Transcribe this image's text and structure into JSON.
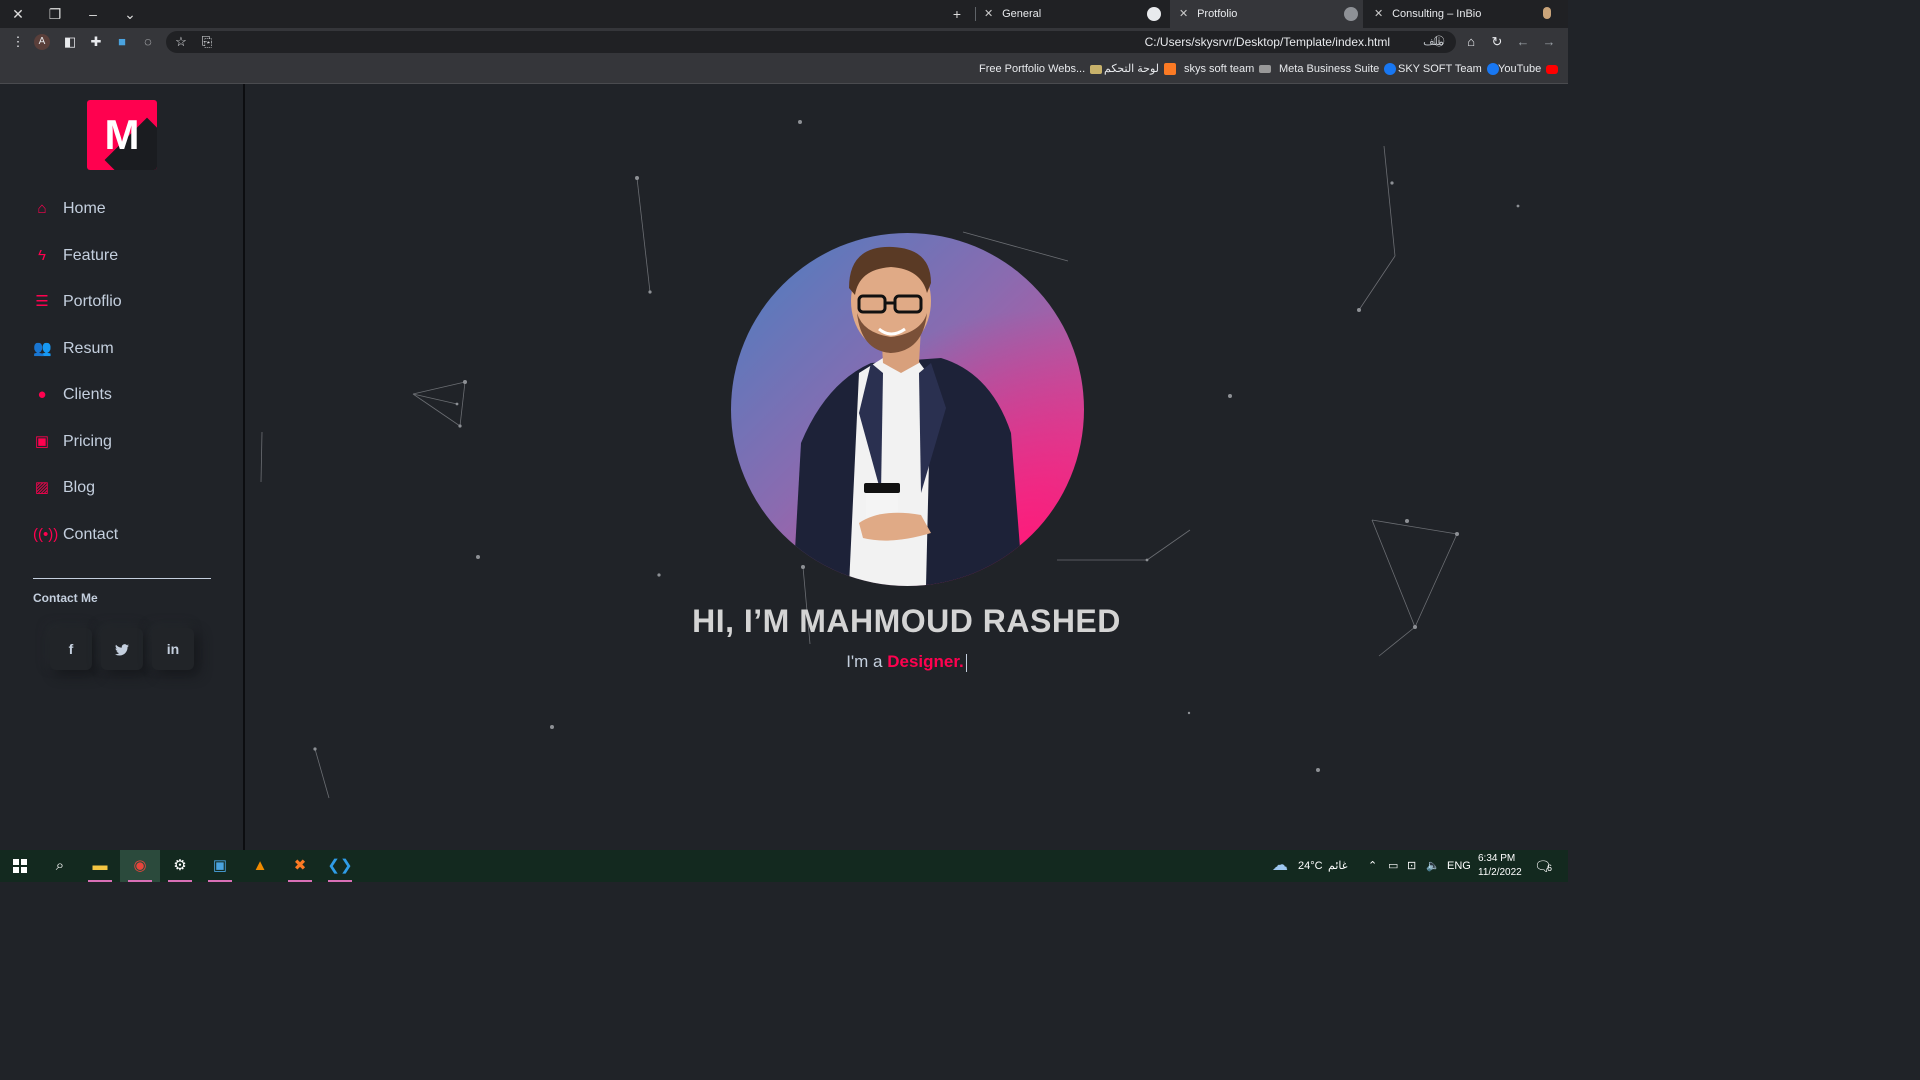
{
  "browser": {
    "tabs": [
      {
        "title": "General",
        "icon": "teams-icon"
      },
      {
        "title": "Protfolio",
        "icon": "github-icon",
        "active": true
      },
      {
        "title": "Consulting – InBio",
        "icon": "globe-icon"
      }
    ],
    "new_tab_label": "+",
    "url": "C:/Users/skysrvr/Desktop/Template/index.html",
    "url_prefix": "ملف",
    "profile_initial": "A",
    "bookmarks": [
      {
        "label": "Free Portfolio Webs...",
        "icon": "image-icon",
        "color": "#c8b26b"
      },
      {
        "label": "لوحة التحكم",
        "icon": "xampp-icon",
        "color": "#fb7a24"
      },
      {
        "label": "skys soft team",
        "icon": "cart-icon",
        "color": "#aaaaaa"
      },
      {
        "label": "Meta Business Suite",
        "icon": "facebook-icon",
        "color": "#1877f2"
      },
      {
        "label": "SKY SOFT Team",
        "icon": "facebook-icon",
        "color": "#1877f2"
      },
      {
        "label": "YouTube",
        "icon": "youtube-icon",
        "color": "#ff0000"
      }
    ]
  },
  "sidebar": {
    "logo_letter": "M",
    "nav": [
      {
        "label": "Home",
        "icon": "home-icon"
      },
      {
        "label": "Feature",
        "icon": "bolt-icon"
      },
      {
        "label": "Portoflio",
        "icon": "list-icon"
      },
      {
        "label": "Resum",
        "icon": "users-icon"
      },
      {
        "label": "Clients",
        "icon": "user-icon"
      },
      {
        "label": "Pricing",
        "icon": "money-icon"
      },
      {
        "label": "Blog",
        "icon": "image-icon"
      },
      {
        "label": "Contact",
        "icon": "broadcast-icon"
      }
    ],
    "contact_title": "Contact Me",
    "social": [
      {
        "label": "f",
        "icon": "facebook-icon"
      },
      {
        "label": "🐦",
        "icon": "twitter-icon"
      },
      {
        "label": "in",
        "icon": "linkedin-icon"
      }
    ]
  },
  "hero": {
    "title": "HI, I’M MAHMOUD RASHED",
    "subtitle_prefix": "I'm a ",
    "subtitle_accent": "Designer."
  },
  "colors": {
    "accent": "#ff014f",
    "background": "#202328",
    "text": "#c4cfde"
  },
  "taskbar": {
    "weather_temp": "24°C",
    "weather_text": "غائم",
    "language": "ENG",
    "time": "6:34 PM",
    "date": "11/2/2022",
    "notifications": "6"
  }
}
